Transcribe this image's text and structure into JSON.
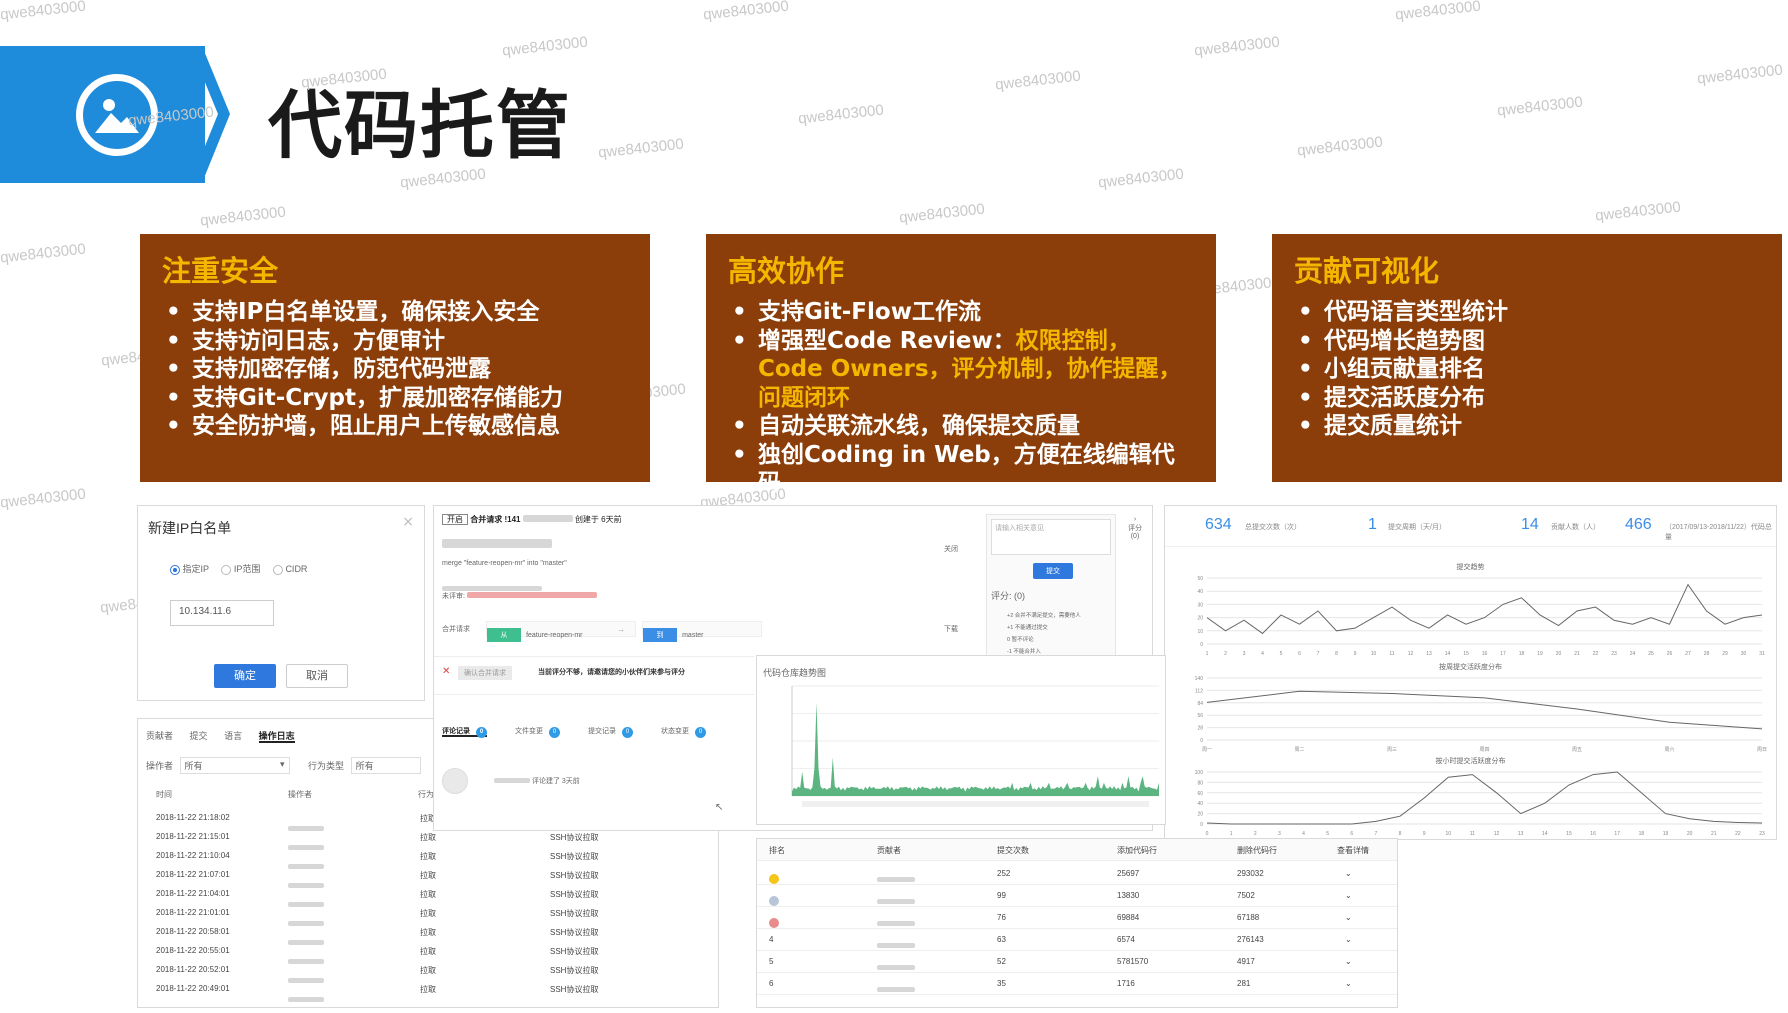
{
  "header": {
    "title": "代码托管",
    "icon": "image-icon",
    "accent_color": "#1f8bdb"
  },
  "watermark_text": "qwe8403000",
  "panels": [
    {
      "title": "注重安全",
      "items": [
        "支持IP白名单设置，确保接入安全",
        "支持访问日志，方便审计",
        "支持加密存储，防范代码泄露",
        "支持Git-Crypt，扩展加密存储能力",
        "安全防护墙，阻止用户上传敏感信息"
      ]
    },
    {
      "title": "高效协作",
      "item1": "支持Git-Flow工作流",
      "item2_prefix": "增强型Code Review：",
      "item2_highlight": "权限控制，Code Owners，评分机制，协作提醒，问题闭环",
      "item3": "自动关联流水线，确保提交质量",
      "item4": "独创Coding in Web，方便在线编辑代码"
    },
    {
      "title": "贡献可视化",
      "items": [
        "代码语言类型统计",
        "代码增长趋势图",
        "小组贡献量排名",
        "提交活跃度分布",
        "提交质量统计"
      ]
    }
  ],
  "panel_colors": {
    "background": "#8b3e0a",
    "title": "#f5b600",
    "text": "#ffffff"
  },
  "ip_whitelist": {
    "title": "新建IP白名单",
    "close": "×",
    "options": [
      "指定IP",
      "IP范围",
      "CIDR"
    ],
    "ip_value": "10.134.11.6",
    "confirm": "确定",
    "cancel": "取消"
  },
  "access_log": {
    "tabs": [
      "贡献者",
      "提交",
      "语言",
      "操作日志"
    ],
    "filter_operator_label": "操作者",
    "filter_operator_value": "所有",
    "filter_type_label": "行为类型",
    "filter_type_value": "所有",
    "col_time": "时间",
    "col_user": "操作者",
    "col_type": "行为",
    "rows": [
      {
        "time": "2018-11-22 21:18:02",
        "type": "拉取",
        "detail": ""
      },
      {
        "time": "2018-11-22 21:15:01",
        "type": "拉取",
        "detail": "SSH协议拉取"
      },
      {
        "time": "2018-11-22 21:10:04",
        "type": "拉取",
        "detail": "SSH协议拉取"
      },
      {
        "time": "2018-11-22 21:07:01",
        "type": "拉取",
        "detail": "SSH协议拉取"
      },
      {
        "time": "2018-11-22 21:04:01",
        "type": "拉取",
        "detail": "SSH协议拉取"
      },
      {
        "time": "2018-11-22 21:01:01",
        "type": "拉取",
        "detail": "SSH协议拉取"
      },
      {
        "time": "2018-11-22 20:58:01",
        "type": "拉取",
        "detail": "SSH协议拉取"
      },
      {
        "time": "2018-11-22 20:55:01",
        "type": "拉取",
        "detail": "SSH协议拉取"
      },
      {
        "time": "2018-11-22 20:52:01",
        "type": "拉取",
        "detail": "SSH协议拉取"
      },
      {
        "time": "2018-11-22 20:49:01",
        "type": "拉取",
        "detail": "SSH协议拉取"
      }
    ]
  },
  "merge_request": {
    "status_badge": "开启",
    "title": "合并请求 !141",
    "suffix": "创建于 6天前",
    "merge_line": "merge \"feature-reopen-mr\" into \"master\"",
    "reviewer_label": "未评审:",
    "branch_label": "合并请求",
    "from_tag": "从",
    "from_branch": "feature-reopen-mr",
    "to_tag": "到",
    "to_branch": "master",
    "close_btn": "关闭",
    "download_btn": "下载",
    "merge_btn": "确认合并请求",
    "warning": "当前评分不够，请邀请您的小伙伴们来参与评分",
    "review_placeholder": "请输入相关意见",
    "submit": "提交",
    "score_label": "评分:",
    "score_value": "(0)",
    "side_label": "评分",
    "side_value": "(0)",
    "rules": [
      "+2 合并不满足提交，需要他人",
      "+1 不能通过提交",
      "0 暂不评论",
      "-1 不能合并入"
    ],
    "tabs": [
      {
        "label": "评论记录",
        "count": "0"
      },
      {
        "label": "文件变更",
        "count": "0"
      },
      {
        "label": "提交记录",
        "count": "0"
      },
      {
        "label": "状态变更",
        "count": "0"
      }
    ],
    "comment_meta": "评论建了 3天前"
  },
  "activity_chart": {
    "title": "代码仓库趋势图",
    "x_labels": [
      "",
      "",
      "",
      "",
      "",
      "",
      "",
      "",
      "",
      ""
    ],
    "color": "#3fa86b"
  },
  "ranking": {
    "headers": [
      "排名",
      "贡献者",
      "提交次数",
      "添加代码行",
      "删除代码行",
      "查看详情"
    ],
    "rows": [
      {
        "rank": "",
        "medal": "#f5c518",
        "commits": "252",
        "added": "25697",
        "deleted": "293032"
      },
      {
        "rank": "",
        "medal": "#b8c4d8",
        "commits": "99",
        "added": "13830",
        "deleted": "7502"
      },
      {
        "rank": "",
        "medal": "#e88b8b",
        "commits": "76",
        "added": "69884",
        "deleted": "67188"
      },
      {
        "rank": "4",
        "medal": "",
        "commits": "63",
        "added": "6574",
        "deleted": "276143"
      },
      {
        "rank": "5",
        "medal": "",
        "commits": "52",
        "added": "5781570",
        "deleted": "4917"
      },
      {
        "rank": "6",
        "medal": "",
        "commits": "35",
        "added": "1716",
        "deleted": "281"
      }
    ]
  },
  "stats": [
    {
      "value": "634",
      "label": "总提交次数（次）"
    },
    {
      "value": "1",
      "label": "提交周期（天/月）"
    },
    {
      "value": "14",
      "label": "贡献人数（人）"
    },
    {
      "value": "466",
      "label": "（2017/09/13-2018/11/22）代码总量"
    }
  ],
  "chart_data": [
    {
      "type": "line",
      "title": "提交趋势",
      "x": [
        1,
        2,
        3,
        4,
        5,
        6,
        7,
        8,
        9,
        10,
        11,
        12,
        13,
        14,
        15,
        16,
        17,
        18,
        19,
        20,
        21,
        22,
        23,
        24,
        25,
        26,
        27,
        28,
        29,
        30,
        31
      ],
      "values": [
        20,
        10,
        18,
        8,
        22,
        15,
        25,
        10,
        12,
        20,
        28,
        18,
        12,
        22,
        15,
        20,
        30,
        35,
        22,
        14,
        25,
        28,
        18,
        15,
        20,
        15,
        45,
        25,
        15,
        20,
        22
      ],
      "ylim": [
        0,
        50
      ]
    },
    {
      "type": "line",
      "title": "按周提交活跃度分布",
      "categories": [
        "周一",
        "周二",
        "周三",
        "周四",
        "周五",
        "周六",
        "周日"
      ],
      "values": [
        85,
        110,
        105,
        95,
        70,
        40,
        25
      ],
      "ylim": [
        0,
        140
      ]
    },
    {
      "type": "line",
      "title": "按小时提交活跃度分布",
      "x": [
        0,
        1,
        2,
        3,
        4,
        5,
        6,
        7,
        8,
        9,
        10,
        11,
        12,
        13,
        14,
        15,
        16,
        17,
        18,
        19,
        20,
        21,
        22,
        23
      ],
      "values": [
        2,
        0,
        0,
        0,
        0,
        0,
        0,
        5,
        15,
        50,
        90,
        95,
        60,
        20,
        40,
        75,
        95,
        100,
        60,
        20,
        10,
        5,
        3,
        2
      ],
      "ylim": [
        0,
        100
      ]
    }
  ]
}
